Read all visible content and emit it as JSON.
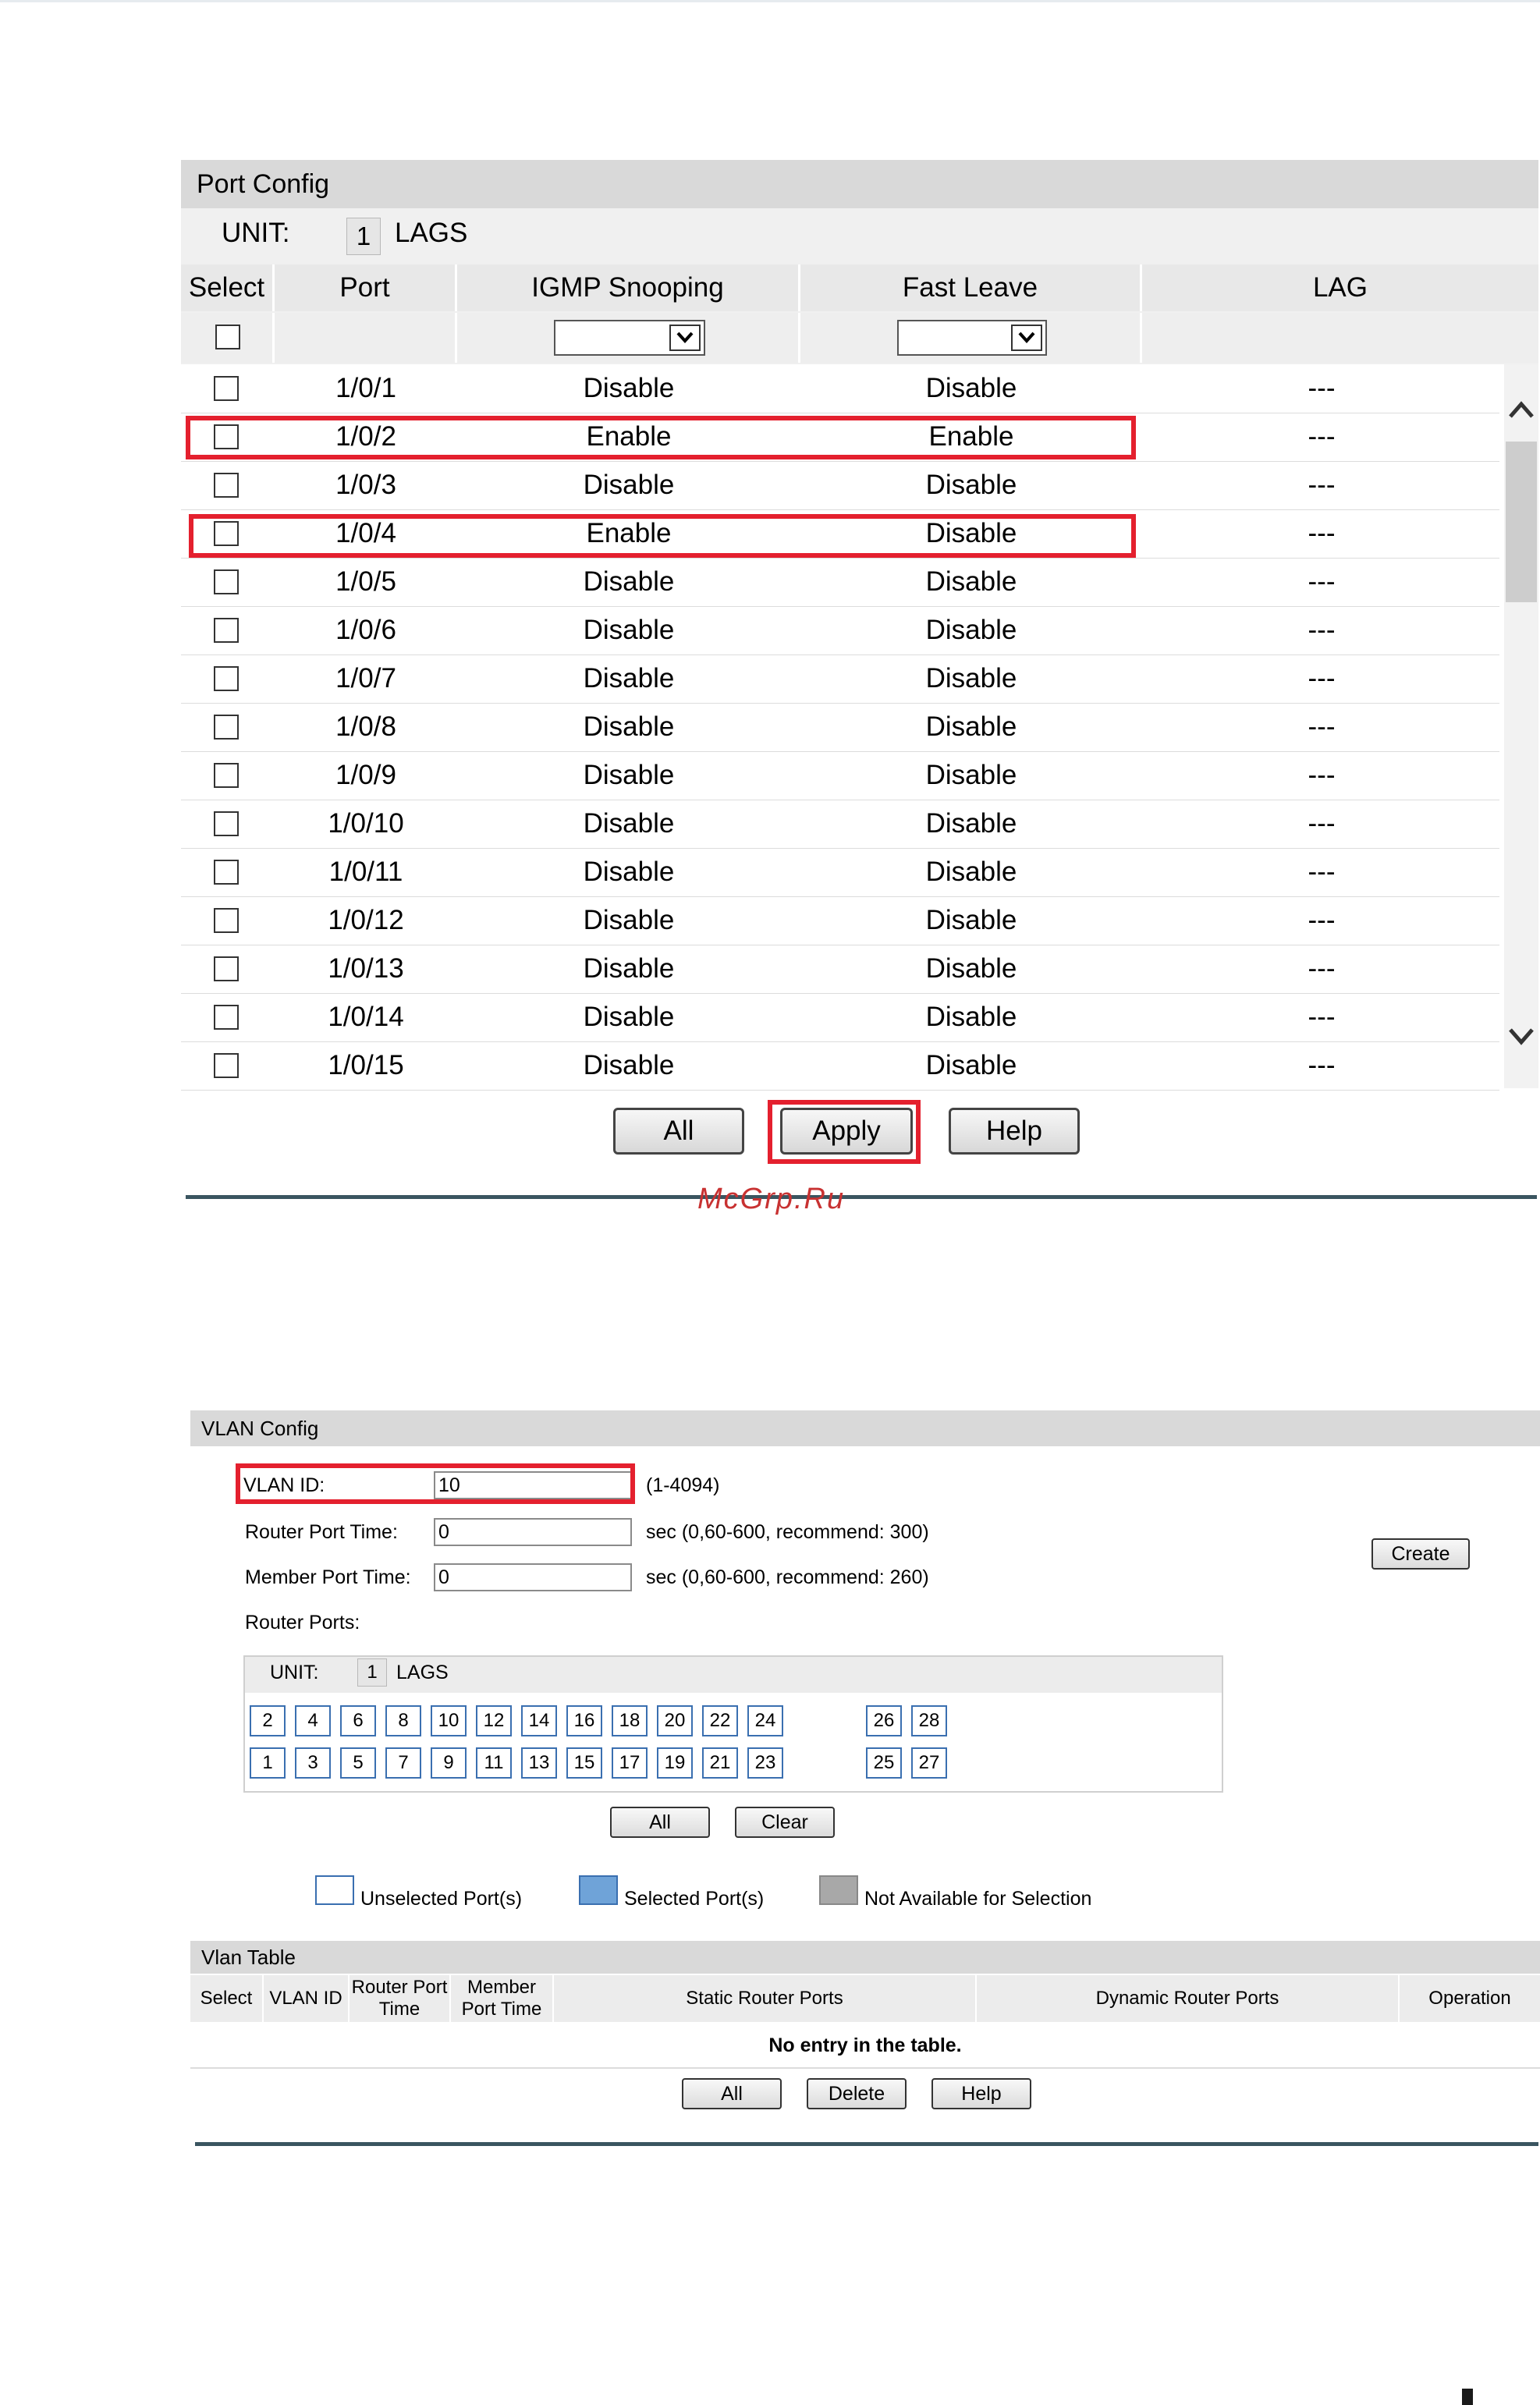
{
  "port_config": {
    "title": "Port Config",
    "unit_label": "UNIT:",
    "unit_value": "1",
    "lags_label": "LAGS",
    "columns": [
      "Select",
      "Port",
      "IGMP Snooping",
      "Fast Leave",
      "LAG"
    ],
    "rows": [
      {
        "port": "1/0/1",
        "igmp": "Disable",
        "fast_leave": "Disable",
        "lag": "---"
      },
      {
        "port": "1/0/2",
        "igmp": "Enable",
        "fast_leave": "Enable",
        "lag": "---"
      },
      {
        "port": "1/0/3",
        "igmp": "Disable",
        "fast_leave": "Disable",
        "lag": "---"
      },
      {
        "port": "1/0/4",
        "igmp": "Enable",
        "fast_leave": "Disable",
        "lag": "---"
      },
      {
        "port": "1/0/5",
        "igmp": "Disable",
        "fast_leave": "Disable",
        "lag": "---"
      },
      {
        "port": "1/0/6",
        "igmp": "Disable",
        "fast_leave": "Disable",
        "lag": "---"
      },
      {
        "port": "1/0/7",
        "igmp": "Disable",
        "fast_leave": "Disable",
        "lag": "---"
      },
      {
        "port": "1/0/8",
        "igmp": "Disable",
        "fast_leave": "Disable",
        "lag": "---"
      },
      {
        "port": "1/0/9",
        "igmp": "Disable",
        "fast_leave": "Disable",
        "lag": "---"
      },
      {
        "port": "1/0/10",
        "igmp": "Disable",
        "fast_leave": "Disable",
        "lag": "---"
      },
      {
        "port": "1/0/11",
        "igmp": "Disable",
        "fast_leave": "Disable",
        "lag": "---"
      },
      {
        "port": "1/0/12",
        "igmp": "Disable",
        "fast_leave": "Disable",
        "lag": "---"
      },
      {
        "port": "1/0/13",
        "igmp": "Disable",
        "fast_leave": "Disable",
        "lag": "---"
      },
      {
        "port": "1/0/14",
        "igmp": "Disable",
        "fast_leave": "Disable",
        "lag": "---"
      },
      {
        "port": "1/0/15",
        "igmp": "Disable",
        "fast_leave": "Disable",
        "lag": "---"
      }
    ],
    "buttons": {
      "all": "All",
      "apply": "Apply",
      "help": "Help"
    }
  },
  "watermark": "McGrp.Ru",
  "vlan_config": {
    "title": "VLAN Config",
    "vlan_id_label": "VLAN ID:",
    "vlan_id_value": "10",
    "vlan_id_hint": "(1-4094)",
    "router_port_time_label": "Router Port Time:",
    "router_port_time_value": "0",
    "router_port_time_hint": "sec (0,60-600, recommend: 300)",
    "member_port_time_label": "Member Port Time:",
    "member_port_time_value": "0",
    "member_port_time_hint": "sec (0,60-600, recommend: 260)",
    "create_label": "Create",
    "router_ports_label": "Router Ports:",
    "unit_label": "UNIT:",
    "unit_value": "1",
    "lags_label": "LAGS",
    "ports_top": [
      "2",
      "4",
      "6",
      "8",
      "10",
      "12",
      "14",
      "16",
      "18",
      "20",
      "22",
      "24"
    ],
    "ports_top_extra": [
      "26",
      "28"
    ],
    "ports_bottom": [
      "1",
      "3",
      "5",
      "7",
      "9",
      "11",
      "13",
      "15",
      "17",
      "19",
      "21",
      "23"
    ],
    "ports_bottom_extra": [
      "25",
      "27"
    ],
    "all_label": "All",
    "clear_label": "Clear",
    "legend": {
      "unselected": "Unselected Port(s)",
      "selected": "Selected Port(s)",
      "not_available": "Not Available for Selection"
    },
    "colors": {
      "unselected": "#ffffff",
      "selected": "#6fa3d8",
      "not_available": "#a8a8a8",
      "highlight": "#e4202e"
    }
  },
  "vlan_table": {
    "title": "Vlan Table",
    "columns": [
      "Select",
      "VLAN ID",
      "Router Port Time",
      "Member Port Time",
      "Static Router Ports",
      "Dynamic Router Ports",
      "Operation"
    ],
    "empty_text": "No entry in the table.",
    "buttons": {
      "all": "All",
      "delete": "Delete",
      "help": "Help"
    }
  }
}
